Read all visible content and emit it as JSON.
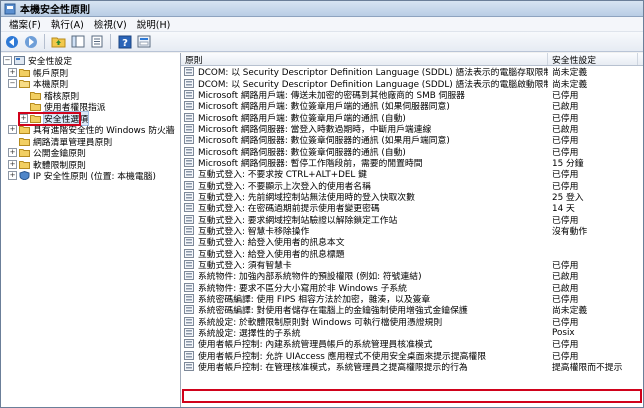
{
  "window": {
    "title": "本機安全性原則"
  },
  "menu": [
    "檔案(F)",
    "執行(A)",
    "檢視(V)",
    "說明(H)"
  ],
  "toolbar": {
    "icons": [
      "back-icon",
      "forward-icon",
      "up-folder-icon",
      "show-tree-icon",
      "export-list-icon",
      "help-icon",
      "properties-icon"
    ]
  },
  "tree": {
    "items": [
      {
        "label": "安全性設定",
        "level": 0,
        "expander": "minus"
      },
      {
        "label": "帳戶原則",
        "level": 1,
        "expander": "plus"
      },
      {
        "label": "本機原則",
        "level": 1,
        "expander": "minus"
      },
      {
        "label": "稽核原則",
        "level": 2,
        "expander": "none"
      },
      {
        "label": "使用者權限指派",
        "level": 2,
        "expander": "none"
      },
      {
        "label": "安全性選項",
        "level": 2,
        "expander": "plus",
        "selected": true
      },
      {
        "label": "具有進階安全性的 Windows 防火牆",
        "level": 1,
        "expander": "plus"
      },
      {
        "label": "網路清單管理員原則",
        "level": 1,
        "expander": "none"
      },
      {
        "label": "公開金鑰原則",
        "level": 1,
        "expander": "plus"
      },
      {
        "label": "軟體限制原則",
        "level": 1,
        "expander": "plus"
      },
      {
        "label": "IP 安全性原則 (位置: 本機電腦)",
        "level": 1,
        "expander": "plus"
      }
    ]
  },
  "list": {
    "headers": {
      "policy": "原則",
      "setting": "安全性設定"
    },
    "rows": [
      {
        "policy": "DCOM: 以 Security Descriptor Definition Language (SDDL) 語法表示的電腦存取限制",
        "setting": "尚未定義"
      },
      {
        "policy": "DCOM: 以 Security Descriptor Definition Language (SDDL) 語法表示的電腦啟動限制",
        "setting": "尚未定義"
      },
      {
        "policy": "Microsoft 網路用戶端: 傳送未加密的密碼到其他廠商的 SMB 伺服器",
        "setting": "已停用"
      },
      {
        "policy": "Microsoft 網路用戶端: 數位簽章用戶端的通訊 (如果伺服器同意)",
        "setting": "已啟用"
      },
      {
        "policy": "Microsoft 網路用戶端: 數位簽章用戶端的通訊 (自動)",
        "setting": "已停用"
      },
      {
        "policy": "Microsoft 網路伺服器: 當登入時數過期時，中斷用戶端連線",
        "setting": "已啟用"
      },
      {
        "policy": "Microsoft 網路伺服器: 數位簽章伺服器的通訊 (如果用戶端同意)",
        "setting": "已停用"
      },
      {
        "policy": "Microsoft 網路伺服器: 數位簽章伺服器的通訊 (自動)",
        "setting": "已停用"
      },
      {
        "policy": "Microsoft 網路伺服器: 暫停工作階段前，需要的閒置時間",
        "setting": "15 分鐘"
      },
      {
        "policy": "互動式登入: 不要求按 CTRL+ALT+DEL 鍵",
        "setting": "已停用"
      },
      {
        "policy": "互動式登入: 不要顯示上次登入的使用者名稱",
        "setting": "已停用"
      },
      {
        "policy": "互動式登入: 先前網域控制站無法使用時的登入快取次數",
        "setting": "25 登入"
      },
      {
        "policy": "互動式登入: 在密碼過期前提示使用者變更密碼",
        "setting": "14 天"
      },
      {
        "policy": "互動式登入: 要求網域控制站驗證以解除鎖定工作站",
        "setting": "已停用"
      },
      {
        "policy": "互動式登入: 智慧卡移除操作",
        "setting": "沒有動作"
      },
      {
        "policy": "互動式登入: 給登入使用者的訊息本文",
        "setting": ""
      },
      {
        "policy": "互動式登入: 給登入使用者的訊息標題",
        "setting": ""
      },
      {
        "policy": "互動式登入: 須有智慧卡",
        "setting": "已停用"
      },
      {
        "policy": "系統物件: 加強內部系統物件的預設權限 (例如: 符號連結)",
        "setting": "已啟用"
      },
      {
        "policy": "系統物件: 要求不區分大小寫用於非 Windows 子系統",
        "setting": "已啟用"
      },
      {
        "policy": "系統密碼編譯: 使用 FIPS 相容方法於加密，雜湊，以及簽章",
        "setting": "已停用"
      },
      {
        "policy": "系統密碼編譯: 對使用者儲存在電腦上的金鑰強制使用增強式金鑰保護",
        "setting": "尚未定義"
      },
      {
        "policy": "系統設定: 於軟體限制原則對 Windows 可執行檔使用憑證規則",
        "setting": "已停用"
      },
      {
        "policy": "系統設定: 選擇性的子系統",
        "setting": "Posix"
      },
      {
        "policy": "使用者帳戶控制: 內建系統管理員帳戶的系統管理員核准模式",
        "setting": "已停用"
      },
      {
        "policy": "使用者帳戶控制: 允許 UIAccess 應用程式不使用安全桌面來提示提高權限",
        "setting": "已停用"
      },
      {
        "policy": "使用者帳戶控制: 在管理核准模式，系統管理員之提高權限提示的行為",
        "setting": "提高權限而不提示",
        "highlighted": true
      }
    ]
  },
  "colors": {
    "highlight_box": "#d0021b",
    "title_bar": "#c7d7eb"
  }
}
